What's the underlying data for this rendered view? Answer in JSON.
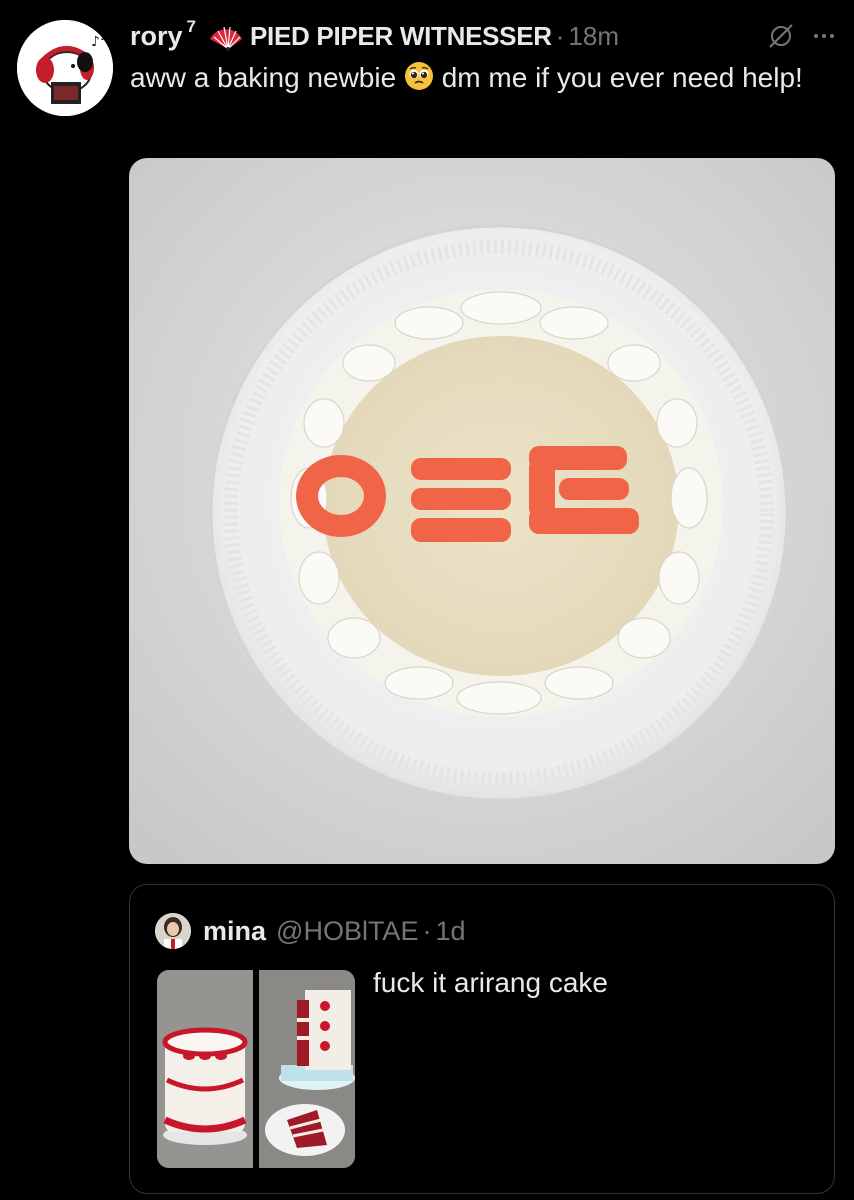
{
  "tweet": {
    "author_name": "rory",
    "author_superscript": "7",
    "author_label": "PIED PIPER WITNESSER",
    "separator": "·",
    "time": "18m",
    "text_before_emoji": "aww a baking newbie ",
    "emoji": "pleading-face-emoji",
    "text_after_emoji": " dm me if you ever need help!",
    "media": {
      "icon": "cake-photo",
      "cake_lettering": "0ΞΞ"
    }
  },
  "quoted_tweet": {
    "author_name": "mina",
    "handle": "@HOBlTAE",
    "separator": "·",
    "time": "1d",
    "text": "fuck it arirang cake"
  },
  "icons": {
    "fan": "folding-fan-icon",
    "hide": "slashed-circle-icon",
    "more": "more-dots-icon"
  },
  "colors": {
    "background": "#000000",
    "text_primary": "#e7e9ea",
    "text_secondary": "#71767b",
    "border": "#2f3336"
  }
}
